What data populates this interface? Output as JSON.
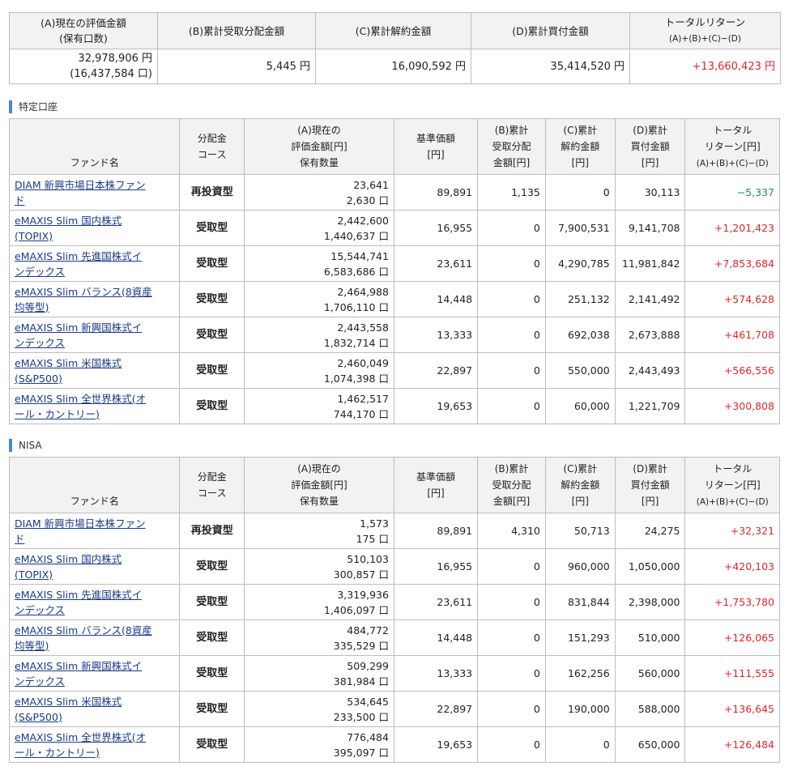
{
  "summary": {
    "headers": [
      "(A)現在の評価金額",
      "(保有口数)",
      "(B)累計受取分配金額",
      "(C)累計解約金額",
      "(D)累計買付金額",
      "トータルリターン",
      "(A)+(B)+(C)−(D)"
    ],
    "values": {
      "a": "32,978,906 円",
      "a_units": "(16,437,584 口)",
      "b": "5,445 円",
      "c": "16,090,592 円",
      "d": "35,414,520 円",
      "total": "+13,660,423 円"
    }
  },
  "columns": {
    "fund": "ファンド名",
    "course_1": "分配金",
    "course_2": "コース",
    "a_1": "(A)現在の",
    "a_2": "評価金額[円]",
    "a_3": "保有数量",
    "nav_1": "基準価額",
    "nav_2": "[円]",
    "b_1": "(B)累計",
    "b_2": "受取分配",
    "b_3": "金額[円]",
    "c_1": "(C)累計",
    "c_2": "解約金額",
    "c_3": "[円]",
    "d_1": "(D)累計",
    "d_2": "買付金額",
    "d_3": "[円]",
    "t_1": "トータル",
    "t_2": "リターン[円]",
    "t_3": "(A)+(B)+(C)−(D)"
  },
  "sections": [
    {
      "title": "特定口座",
      "rows": [
        {
          "name_1": "DIAM 新興市場日本株ファン",
          "name_2": "ド",
          "course": "再投資型",
          "value": "23,641",
          "units": "2,630 口",
          "nav": "89,891",
          "b": "1,135",
          "c": "0",
          "d": "30,113",
          "total": "−5,337",
          "sign": "neg"
        },
        {
          "name_1": "eMAXIS Slim 国内株式",
          "name_2": "(TOPIX)",
          "course": "受取型",
          "value": "2,442,600",
          "units": "1,440,637 口",
          "nav": "16,955",
          "b": "0",
          "c": "7,900,531",
          "d": "9,141,708",
          "total": "+1,201,423",
          "sign": "pos"
        },
        {
          "name_1": "eMAXIS Slim 先進国株式イ",
          "name_2": "ンデックス",
          "course": "受取型",
          "value": "15,544,741",
          "units": "6,583,686 口",
          "nav": "23,611",
          "b": "0",
          "c": "4,290,785",
          "d": "11,981,842",
          "total": "+7,853,684",
          "sign": "pos"
        },
        {
          "name_1": "eMAXIS Slim バランス(8資産",
          "name_2": "均等型)",
          "course": "受取型",
          "value": "2,464,988",
          "units": "1,706,110 口",
          "nav": "14,448",
          "b": "0",
          "c": "251,132",
          "d": "2,141,492",
          "total": "+574,628",
          "sign": "pos"
        },
        {
          "name_1": "eMAXIS Slim 新興国株式イ",
          "name_2": "ンデックス",
          "course": "受取型",
          "value": "2,443,558",
          "units": "1,832,714 口",
          "nav": "13,333",
          "b": "0",
          "c": "692,038",
          "d": "2,673,888",
          "total": "+461,708",
          "sign": "pos"
        },
        {
          "name_1": "eMAXIS Slim 米国株式",
          "name_2": "(S&P500)",
          "course": "受取型",
          "value": "2,460,049",
          "units": "1,074,398 口",
          "nav": "22,897",
          "b": "0",
          "c": "550,000",
          "d": "2,443,493",
          "total": "+566,556",
          "sign": "pos"
        },
        {
          "name_1": "eMAXIS Slim 全世界株式(オ",
          "name_2": "ール・カントリー)",
          "course": "受取型",
          "value": "1,462,517",
          "units": "744,170 口",
          "nav": "19,653",
          "b": "0",
          "c": "60,000",
          "d": "1,221,709",
          "total": "+300,808",
          "sign": "pos"
        }
      ]
    },
    {
      "title": "NISA",
      "rows": [
        {
          "name_1": "DIAM 新興市場日本株ファン",
          "name_2": "ド",
          "course": "再投資型",
          "value": "1,573",
          "units": "175 口",
          "nav": "89,891",
          "b": "4,310",
          "c": "50,713",
          "d": "24,275",
          "total": "+32,321",
          "sign": "pos"
        },
        {
          "name_1": "eMAXIS Slim 国内株式",
          "name_2": "(TOPIX)",
          "course": "受取型",
          "value": "510,103",
          "units": "300,857 口",
          "nav": "16,955",
          "b": "0",
          "c": "960,000",
          "d": "1,050,000",
          "total": "+420,103",
          "sign": "pos"
        },
        {
          "name_1": "eMAXIS Slim 先進国株式イ",
          "name_2": "ンデックス",
          "course": "受取型",
          "value": "3,319,936",
          "units": "1,406,097 口",
          "nav": "23,611",
          "b": "0",
          "c": "831,844",
          "d": "2,398,000",
          "total": "+1,753,780",
          "sign": "pos"
        },
        {
          "name_1": "eMAXIS Slim バランス(8資産",
          "name_2": "均等型)",
          "course": "受取型",
          "value": "484,772",
          "units": "335,529 口",
          "nav": "14,448",
          "b": "0",
          "c": "151,293",
          "d": "510,000",
          "total": "+126,065",
          "sign": "pos"
        },
        {
          "name_1": "eMAXIS Slim 新興国株式イ",
          "name_2": "ンデックス",
          "course": "受取型",
          "value": "509,299",
          "units": "381,984 口",
          "nav": "13,333",
          "b": "0",
          "c": "162,256",
          "d": "560,000",
          "total": "+111,555",
          "sign": "pos"
        },
        {
          "name_1": "eMAXIS Slim 米国株式",
          "name_2": "(S&P500)",
          "course": "受取型",
          "value": "534,645",
          "units": "233,500 口",
          "nav": "22,897",
          "b": "0",
          "c": "190,000",
          "d": "588,000",
          "total": "+136,645",
          "sign": "pos"
        },
        {
          "name_1": "eMAXIS Slim 全世界株式(オ",
          "name_2": "ール・カントリー)",
          "course": "受取型",
          "value": "776,484",
          "units": "395,097 口",
          "nav": "19,653",
          "b": "0",
          "c": "0",
          "d": "650,000",
          "total": "+126,484",
          "sign": "pos"
        }
      ]
    }
  ],
  "colors": {
    "positive": "#e2262a",
    "negative": "#1a9a3a",
    "link": "#1a3a8a",
    "header_bg": "#f2f2f2",
    "accent": "#4a86c5"
  }
}
